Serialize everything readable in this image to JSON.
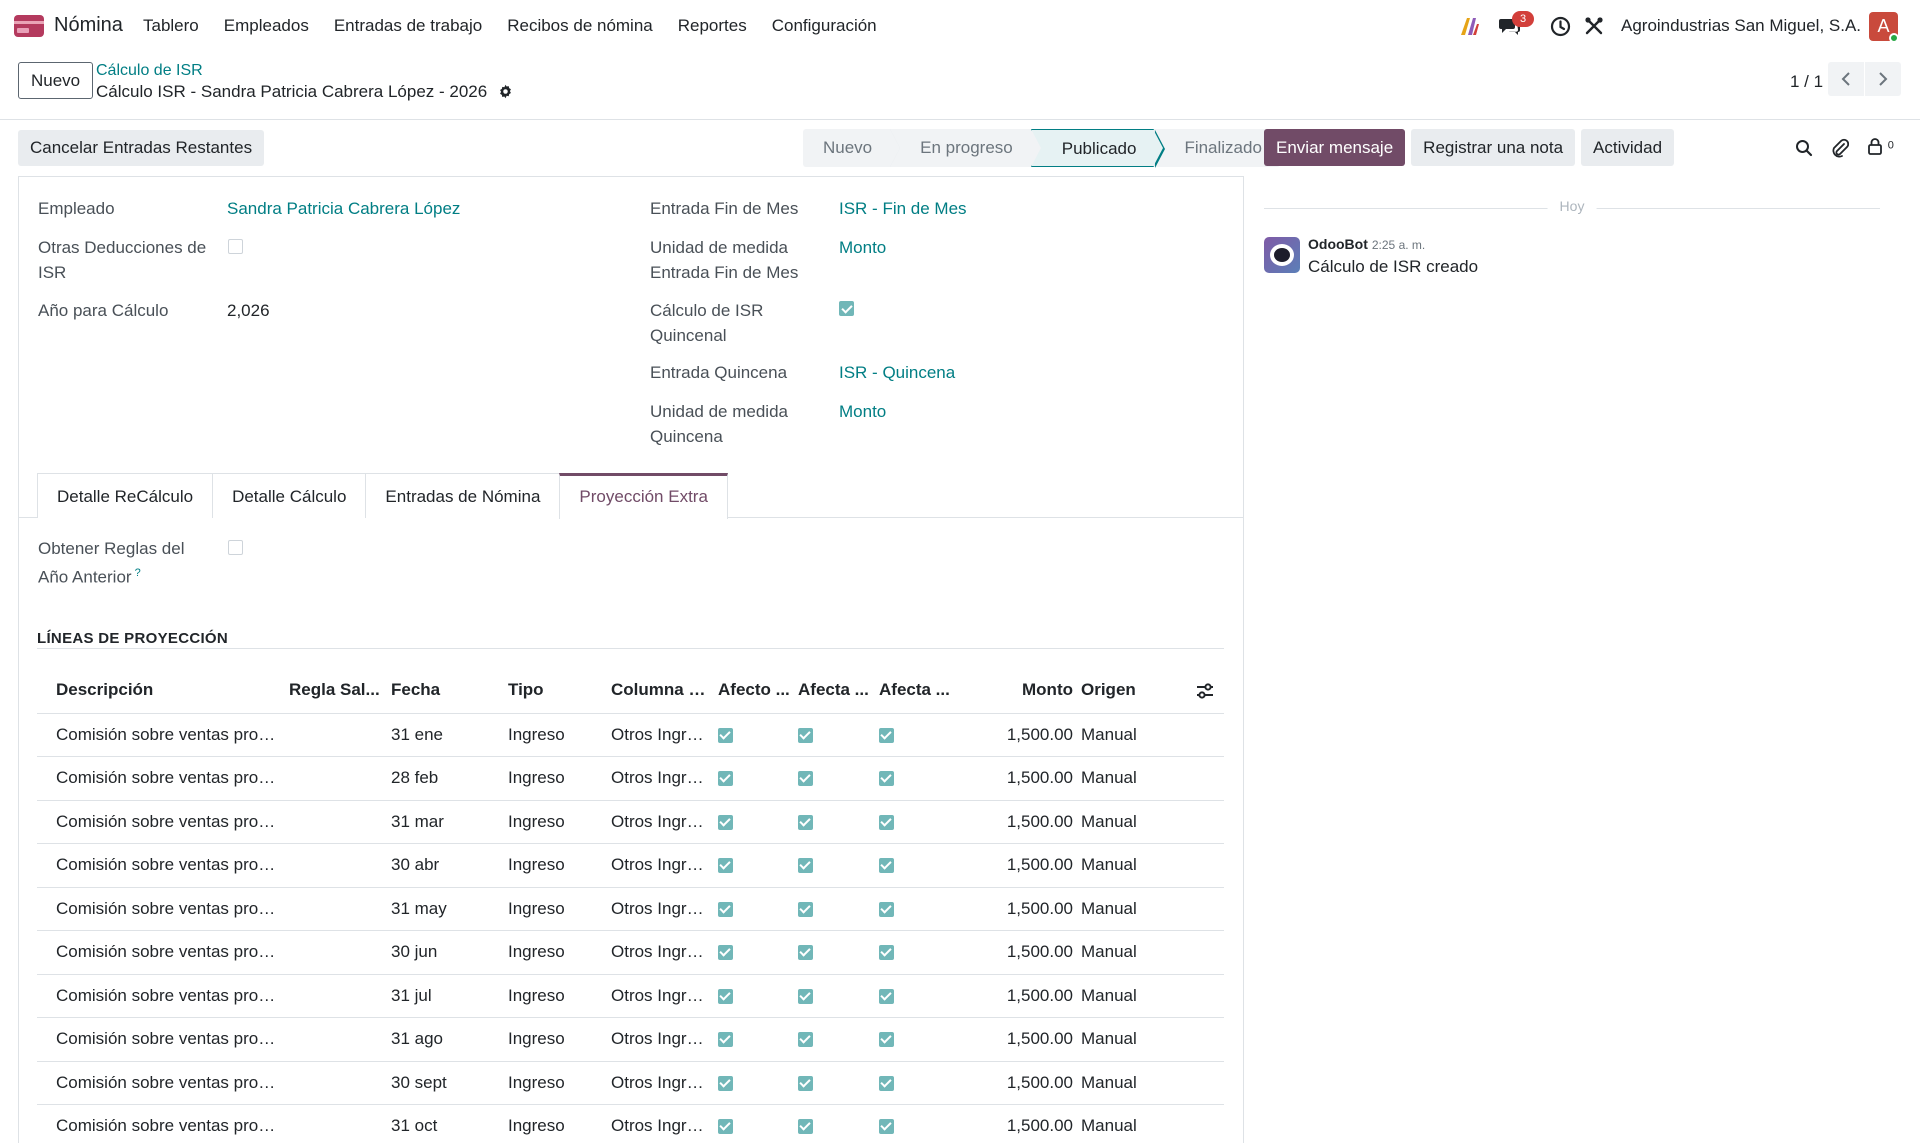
{
  "app": {
    "name": "Nómina",
    "menu": [
      "Tablero",
      "Empleados",
      "Entradas de trabajo",
      "Recibos de nómina",
      "Reportes",
      "Configuración"
    ],
    "chat_badge": "3",
    "company": "Agroindustrias San Miguel, S.A.",
    "avatar_initial": "A"
  },
  "control": {
    "new_label": "Nuevo",
    "breadcrumb_parent": "Cálculo de ISR",
    "record_title": "Cálculo ISR - Sandra Patricia Cabrera López - 2026",
    "pager": "1 / 1"
  },
  "statusbar": {
    "action_label": "Cancelar Entradas Restantes",
    "stages": [
      "Nuevo",
      "En progreso",
      "Publicado",
      "Finalizado"
    ],
    "active_stage": "Publicado"
  },
  "form": {
    "employee_label": "Empleado",
    "employee_value": "Sandra Patricia Cabrera López",
    "other_deductions_label": "Otras Deducciones de ISR",
    "year_label": "Año para Cálculo",
    "year_value": "2,026",
    "month_end_entry_label": "Entrada Fin de Mes",
    "month_end_entry_value": "ISR - Fin de Mes",
    "month_end_unit_label": "Unidad de medida Entrada Fin de Mes",
    "month_end_unit_value": "Monto",
    "biweekly_calc_label": "Cálculo de ISR Quincenal",
    "biweekly_entry_label": "Entrada Quincena",
    "biweekly_entry_value": "ISR - Quincena",
    "biweekly_unit_label": "Unidad de medida Quincena",
    "biweekly_unit_value": "Monto"
  },
  "tabs": [
    "Detalle ReCálculo",
    "Detalle Cálculo",
    "Entradas de Nómina",
    "Proyección Extra"
  ],
  "active_tab": "Proyección Extra",
  "projection": {
    "prev_year_label": "Obtener Reglas del Año Anterior",
    "help_mark": "?",
    "section_title": "LÍNEAS DE PROYECCIÓN",
    "columns": [
      "Descripción",
      "Regla Sal...",
      "Fecha",
      "Tipo",
      "Columna D...",
      "Afecto ...",
      "Afecta ...",
      "Afecta ...",
      "Monto",
      "Origen"
    ],
    "rows": [
      {
        "desc": "Comisión sobre ventas proyec...",
        "rule": "",
        "date": "31 ene",
        "type": "Ingreso",
        "column": "Otros Ingre...",
        "amount": "1,500.00",
        "origin": "Manual"
      },
      {
        "desc": "Comisión sobre ventas proyec...",
        "rule": "",
        "date": "28 feb",
        "type": "Ingreso",
        "column": "Otros Ingre...",
        "amount": "1,500.00",
        "origin": "Manual"
      },
      {
        "desc": "Comisión sobre ventas proyec...",
        "rule": "",
        "date": "31 mar",
        "type": "Ingreso",
        "column": "Otros Ingre...",
        "amount": "1,500.00",
        "origin": "Manual"
      },
      {
        "desc": "Comisión sobre ventas proyec...",
        "rule": "",
        "date": "30 abr",
        "type": "Ingreso",
        "column": "Otros Ingre...",
        "amount": "1,500.00",
        "origin": "Manual"
      },
      {
        "desc": "Comisión sobre ventas proyec...",
        "rule": "",
        "date": "31 may",
        "type": "Ingreso",
        "column": "Otros Ingre...",
        "amount": "1,500.00",
        "origin": "Manual"
      },
      {
        "desc": "Comisión sobre ventas proyec...",
        "rule": "",
        "date": "30 jun",
        "type": "Ingreso",
        "column": "Otros Ingre...",
        "amount": "1,500.00",
        "origin": "Manual"
      },
      {
        "desc": "Comisión sobre ventas proyec...",
        "rule": "",
        "date": "31 jul",
        "type": "Ingreso",
        "column": "Otros Ingre...",
        "amount": "1,500.00",
        "origin": "Manual"
      },
      {
        "desc": "Comisión sobre ventas proyec...",
        "rule": "",
        "date": "31 ago",
        "type": "Ingreso",
        "column": "Otros Ingre...",
        "amount": "1,500.00",
        "origin": "Manual"
      },
      {
        "desc": "Comisión sobre ventas proyec...",
        "rule": "",
        "date": "30 sept",
        "type": "Ingreso",
        "column": "Otros Ingre...",
        "amount": "1,500.00",
        "origin": "Manual"
      },
      {
        "desc": "Comisión sobre ventas proyec...",
        "rule": "",
        "date": "31 oct",
        "type": "Ingreso",
        "column": "Otros Ingre...",
        "amount": "1,500.00",
        "origin": "Manual"
      }
    ]
  },
  "chatter": {
    "send_message": "Enviar mensaje",
    "log_note": "Registrar una nota",
    "activity": "Actividad",
    "followers_count": "0",
    "today": "Hoy",
    "message_author": "OdooBot",
    "message_time": "2:25 a. m.",
    "message_body": "Cálculo de ISR creado"
  },
  "colors": {
    "brand": "#714b67",
    "link": "#017e84",
    "checkbox": "#71b7b8",
    "badge": "#d23f3a"
  }
}
